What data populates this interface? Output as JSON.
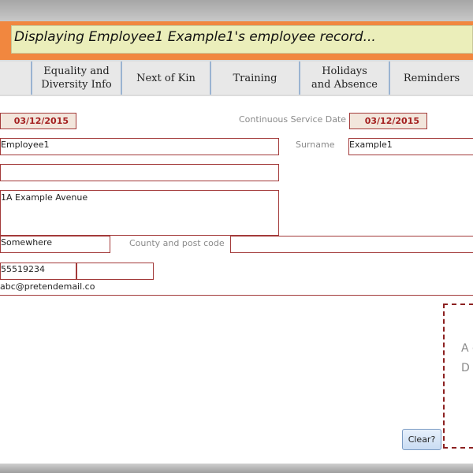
{
  "header": {
    "banner_text": "Displaying Employee1 Example1's employee record..."
  },
  "tabs": [
    {
      "label": "Equality and Diversity Info"
    },
    {
      "label": "Next of Kin"
    },
    {
      "label": "Training"
    },
    {
      "label": "Holidays and Absence"
    },
    {
      "label": "Reminders"
    }
  ],
  "form": {
    "start_date": "03/12/2015",
    "continuous_service_label": "Continuous Service Date",
    "continuous_service_date": "03/12/2015",
    "forename": "Employee1",
    "surname_label": "Surname",
    "surname": "Example1",
    "middle_name": "",
    "address": "1A Example Avenue",
    "town": "Somewhere",
    "county_postcode_label": "County and post code",
    "county": "",
    "phone": "55519234",
    "mobile": "",
    "email": "abc@pretendemail.co"
  },
  "dropzone": {
    "text": "A c D to"
  },
  "actions": {
    "clear_label": "Clear?"
  }
}
